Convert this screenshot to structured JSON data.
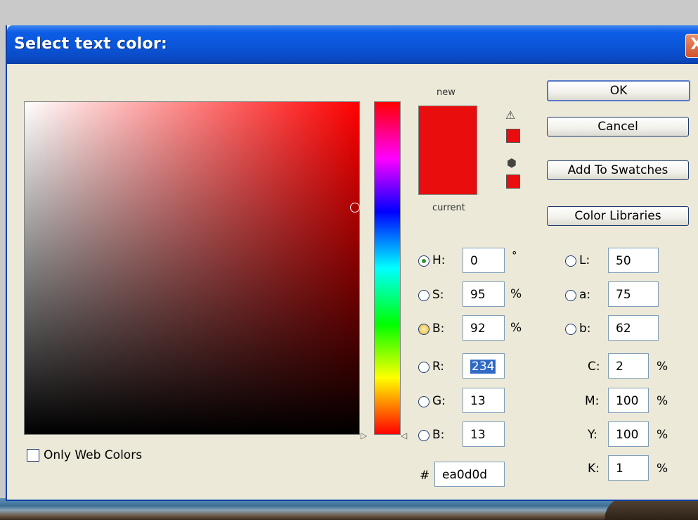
{
  "dialog": {
    "title": "Select text color:",
    "close_glyph": "X"
  },
  "swatch": {
    "new_label": "new",
    "current_label": "current",
    "new_color": "#ea0d0d",
    "current_color": "#ea0d0d",
    "gamut_warning_icon": "warning-triangle-icon",
    "web_safe_icon": "cube-icon"
  },
  "buttons": {
    "ok": "OK",
    "cancel": "Cancel",
    "add_to_swatches": "Add To Swatches",
    "color_libraries": "Color Libraries"
  },
  "hsb": {
    "h": {
      "label": "H:",
      "value": "0",
      "unit": "°"
    },
    "s": {
      "label": "S:",
      "value": "95",
      "unit": "%"
    },
    "b": {
      "label": "B:",
      "value": "92",
      "unit": "%"
    }
  },
  "rgb": {
    "r": {
      "label": "R:",
      "value": "234"
    },
    "g": {
      "label": "G:",
      "value": "13"
    },
    "b": {
      "label": "B:",
      "value": "13"
    }
  },
  "lab": {
    "l": {
      "label": "L:",
      "value": "50"
    },
    "a": {
      "label": "a:",
      "value": "75"
    },
    "b": {
      "label": "b:",
      "value": "62"
    }
  },
  "cmyk": {
    "c": {
      "label": "C:",
      "value": "2",
      "unit": "%"
    },
    "m": {
      "label": "M:",
      "value": "100",
      "unit": "%"
    },
    "y": {
      "label": "Y:",
      "value": "100",
      "unit": "%"
    },
    "k": {
      "label": "K:",
      "value": "1",
      "unit": "%"
    }
  },
  "hex": {
    "label": "#",
    "value": "ea0d0d"
  },
  "only_web_colors": {
    "label": "Only Web Colors",
    "checked": false
  }
}
